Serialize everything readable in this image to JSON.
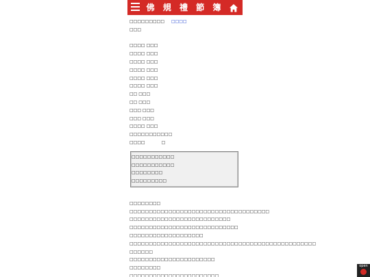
{
  "header": {
    "title": "佛 規 禮 節 簿",
    "menu_icon": "hamburger-menu-icon",
    "home_icon": "home-icon",
    "background": "#d42a26"
  },
  "breadcrumb": {
    "text": "□□□□□□□□□",
    "link": "□□□□"
  },
  "lines_top": [
    "□□□",
    "",
    "□□□□ □□□",
    "□□□□ □□□",
    "□□□□ □□□",
    "□□□□ □□□",
    "□□□□ □□□",
    "□□□□ □□□",
    "□□ □□□",
    "□□ □□□",
    "□□□ □□□",
    "□□□ □□□",
    "□□□□ □□□",
    "□□□□□□□□□□□"
  ],
  "tail_line": {
    "text": "□□□□",
    "marker": "□"
  },
  "toc": [
    "□□□□□□□□□□□",
    "□□□□□□□□□□□",
    "□□□□□□□□",
    "□□□□□□□□□"
  ],
  "body_lines": [
    "□□□□□□□□",
    "□□□□□□□□□□□□□□□□□□□□□□□□□□□□□□□□□□□□",
    "□□□□□□□□□□□□□□□□□□□□□□□□□□",
    "□□□□□□□□□□□□□□□□□□□□□□□□□□□□",
    "□□□□□□□□□□□□□□□□□□□",
    "□□□□□□□□□□□□□□□□□□□□□□□□□□□□□□□□□□□□□□□□□□□□□□□□",
    "□□□□□□",
    "□□□□□□□□□□□□□□□□□□□□□□",
    "□□□□□□□□",
    "□□□□□□□□□□□□□□□□□□□□□□□"
  ],
  "badge": {
    "label": "open",
    "accent": "#d42a26"
  }
}
